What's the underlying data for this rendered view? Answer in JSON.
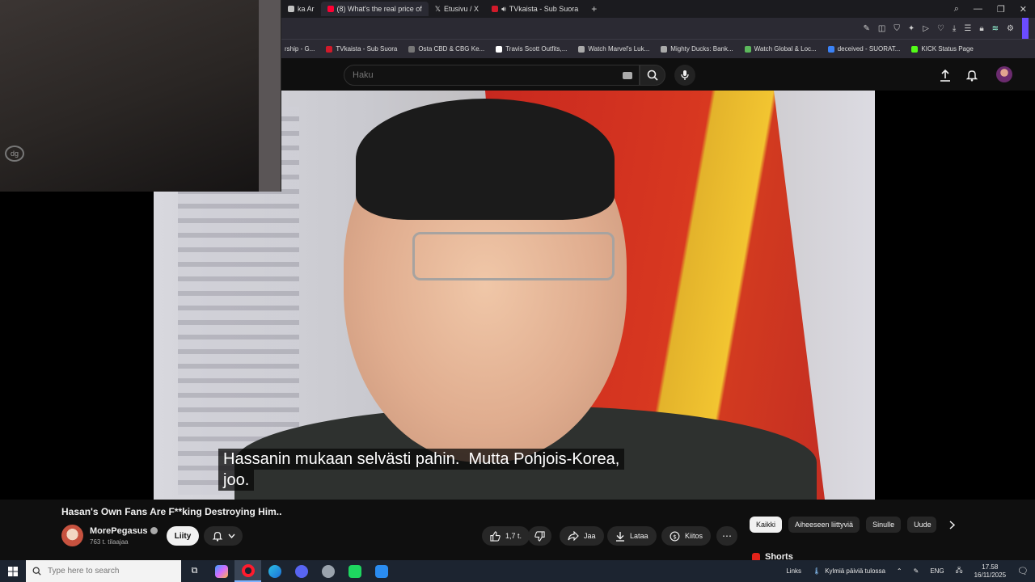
{
  "browser": {
    "tabs": [
      {
        "label": "ka Ar",
        "color": "#c2c2c2"
      },
      {
        "label": "(8) What's the real price of",
        "color": "#ff0033"
      },
      {
        "label": "Etusivu / X",
        "color": "#ffffff"
      },
      {
        "label": "TVkaista - Sub Suora",
        "color": "#d11a2a"
      }
    ],
    "new_tab": "+",
    "window_controls": [
      "—",
      "❐",
      "✕"
    ],
    "bookmarks": [
      {
        "label": "rship - G...",
        "color": "#888888"
      },
      {
        "label": "TVkaista - Sub Suora",
        "color": "#d11a2a"
      },
      {
        "label": "Osta CBD & CBG Ke...",
        "color": "#777777"
      },
      {
        "label": "Travis Scott Outfits,...",
        "color": "#ffffff"
      },
      {
        "label": "Watch Marvel's Luk...",
        "color": "#aaaaaa"
      },
      {
        "label": "Mighty Ducks: Bank...",
        "color": "#aaaaaa"
      },
      {
        "label": "Watch Global & Loc...",
        "color": "#5cb85c"
      },
      {
        "label": "deceived - SUORAT...",
        "color": "#3b82f6"
      },
      {
        "label": "KICK Status Page",
        "color": "#53fc18"
      }
    ]
  },
  "youtube": {
    "search_placeholder": "Haku",
    "video": {
      "subtitle_line1": "Hassanin mukaan selvästi pahin.  Mutta Pohjois-Korea,",
      "subtitle_line2": "joo."
    },
    "title": "Hasan's Own Fans Are F**king Destroying Him..",
    "channel": {
      "name": "MorePegasus",
      "subscribers": "763 t. tilaajaa",
      "join_label": "Liity"
    },
    "actions": {
      "likes": "1,7 t.",
      "share": "Jaa",
      "download": "Lataa",
      "thanks": "Kiitos",
      "more": "⋯"
    },
    "chips": [
      "Kaikki",
      "Aiheeseen liittyviä",
      "Sinulle",
      "Uude"
    ],
    "shorts_label": "Shorts"
  },
  "taskbar": {
    "search_placeholder": "Type here to search",
    "links_label": "Links",
    "weather": "Kylmiä päiviä tulossa",
    "language": "ENG",
    "time": "17.58",
    "date": "16/11/2025"
  }
}
